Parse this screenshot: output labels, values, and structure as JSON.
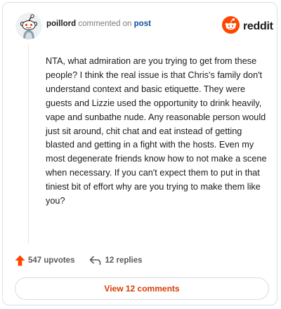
{
  "header": {
    "username": "poillord",
    "action_text": "commented on",
    "link_text": "post",
    "avatar_icon": "snoo-avatar-icon"
  },
  "brand": {
    "logo_icon": "reddit-snoo-logo-icon",
    "wordmark": "reddit",
    "accent_color": "#ff4500"
  },
  "comment": {
    "text": "NTA, what admiration are you trying to get from these people? I think the real issue is that Chris's family don't understand context and basic etiquette. They were guests and Lizzie used the opportunity to drink heavily, vape and sunbathe nude. Any reasonable person would just sit around, chit chat and eat instead of getting blasted and getting in a fight with the hosts. Even my most degenerate friends know how to not make a scene when necessary. If you can't expect them to put in that tiniest bit of effort why are you trying to make them like you?"
  },
  "actions": {
    "upvotes_label": "547 upvotes",
    "upvote_icon": "upvote-arrow-icon",
    "upvote_color": "#ff4500",
    "replies_label": "12 replies",
    "reply_icon": "reply-arrow-icon"
  },
  "footer": {
    "view_button_label": "View 12 comments",
    "button_text_color": "#d93a00"
  }
}
